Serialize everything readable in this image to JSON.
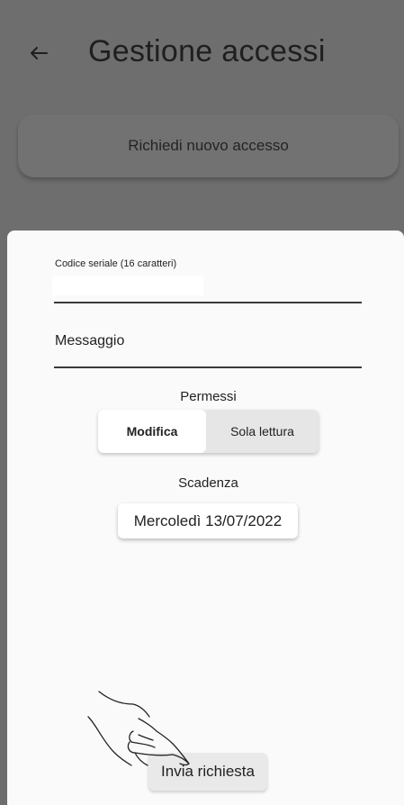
{
  "appbar": {
    "title": "Gestione accessi",
    "back_icon": "arrow-left-icon"
  },
  "main": {
    "request_button_label": "Richiedi nuovo accesso"
  },
  "sheet": {
    "serial_label": "Codice seriale (16 caratteri)",
    "serial_value": "",
    "message_label": "Messaggio",
    "permissions_title": "Permessi",
    "permissions_options": [
      "Modifica",
      "Sola lettura"
    ],
    "permissions_selected": "Modifica",
    "expiry_title": "Scadenza",
    "expiry_value": "Mercoledì 13/07/2022",
    "submit_label": "Invia richiesta"
  },
  "colors": {
    "scrim": "#6e6e6e",
    "sheet": "#fafafa",
    "selected_toggle": "#ffffff",
    "toggle_bg": "#e6e6e6"
  },
  "icons": {
    "hand": "hand-pointer-icon"
  }
}
